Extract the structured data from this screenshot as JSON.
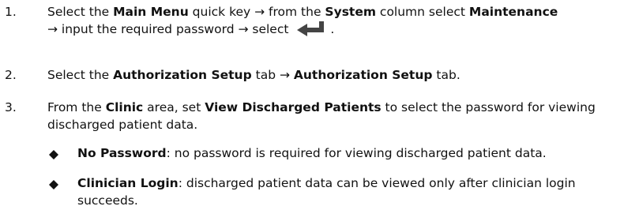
{
  "steps": [
    {
      "number": "1.",
      "parts": [
        "Select the ",
        "Main Menu",
        " quick key → from the ",
        "System",
        " column select ",
        "Maintenance",
        " → input the required password → select ",
        "."
      ],
      "icon": "enter-key-icon"
    },
    {
      "number": "2.",
      "parts": [
        "Select the ",
        "Authorization Setup",
        " tab → ",
        "Authorization Setup",
        " tab."
      ]
    },
    {
      "number": "3.",
      "parts": [
        "From the ",
        "Clinic",
        " area, set ",
        "View Discharged Patients",
        " to select the password for viewing discharged patient data."
      ]
    }
  ],
  "bullets": [
    {
      "term": "No Password",
      "description": ": no password is required for viewing discharged patient data."
    },
    {
      "term": "Clinician Login",
      "description": ": discharged patient data can be viewed only after clinician login succeeds."
    }
  ]
}
